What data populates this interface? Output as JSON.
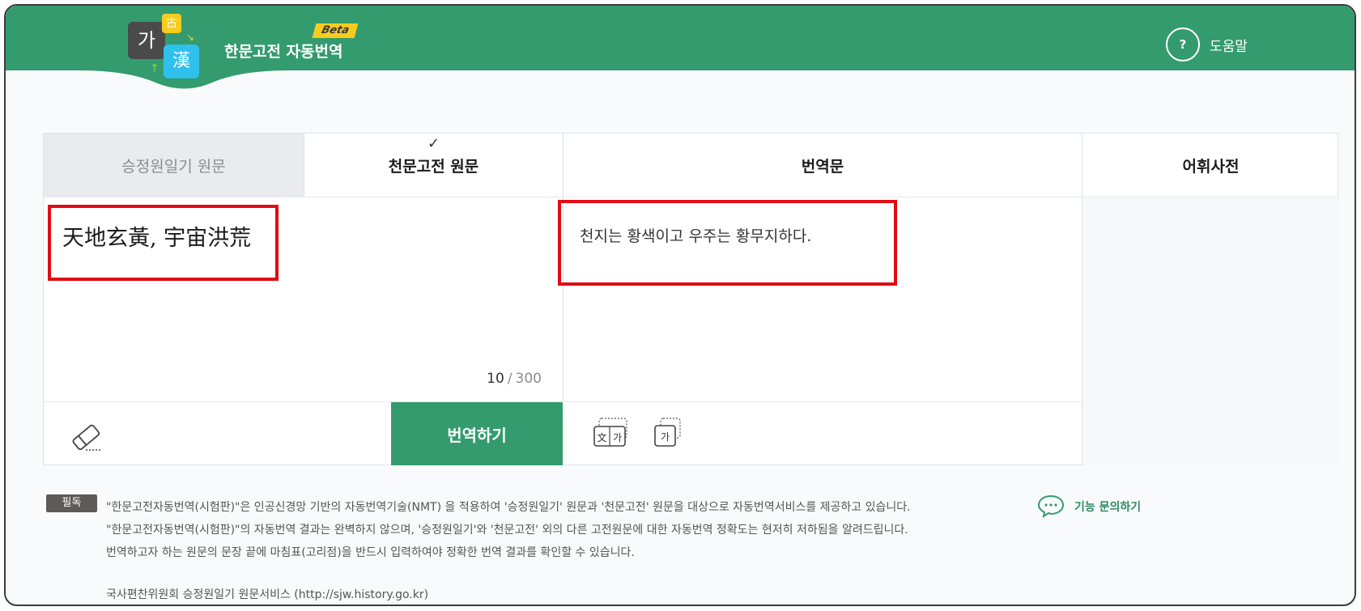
{
  "header": {
    "logo": {
      "ga": "가",
      "han": "漢",
      "go": "古"
    },
    "title": "한문고전 자동번역",
    "beta": "Beta",
    "help_icon": "?",
    "help_label": "도움말"
  },
  "tabs": {
    "source_sjw": "승정원일기 원문",
    "source_cheonmun": "천문고전 원문",
    "translation": "번역문",
    "dictionary": "어휘사전"
  },
  "source": {
    "text": "天地玄黃, 宇宙洪荒",
    "char_count": "10",
    "char_sep": "/",
    "char_max": "300"
  },
  "translation": {
    "text": "천지는 황색이고 우주는 황무지하다."
  },
  "buttons": {
    "translate": "번역하기"
  },
  "tool_icons": {
    "hanja_hangul": {
      "left": "文",
      "right": "가"
    },
    "hangul_copy": "가"
  },
  "notice": {
    "badge": "필독",
    "lines": [
      "\"한문고전자동번역(시험판)\"은 인공신경망 기반의 자동번역기술(NMT) 을 적용하여 '승정원일기' 원문과 '천문고전' 원문을 대상으로 자동번역서비스를 제공하고 있습니다.",
      "\"한문고전자동번역(시험판)\"의 자동번역 결과는 완벽하지 않으며, '승정원일기'와 '천문고전' 외의 다른 고전원문에 대한 자동번역 정확도는 현저히 저하됨을 알려드립니다.",
      "번역하고자 하는 원문의 문장 끝에 마침표(고리점)을 반드시 입력하여야 정확한 번역 결과를 확인할 수 있습니다."
    ],
    "source": "국사편찬위원회 승정원일기 원문서비스 (http://sjw.history.go.kr)"
  },
  "inquiry": {
    "label": "기능 문의하기"
  },
  "colors": {
    "brand_green": "#349b6e",
    "beta_yellow": "#f6cd1e",
    "highlight_red": "#e10c14"
  }
}
